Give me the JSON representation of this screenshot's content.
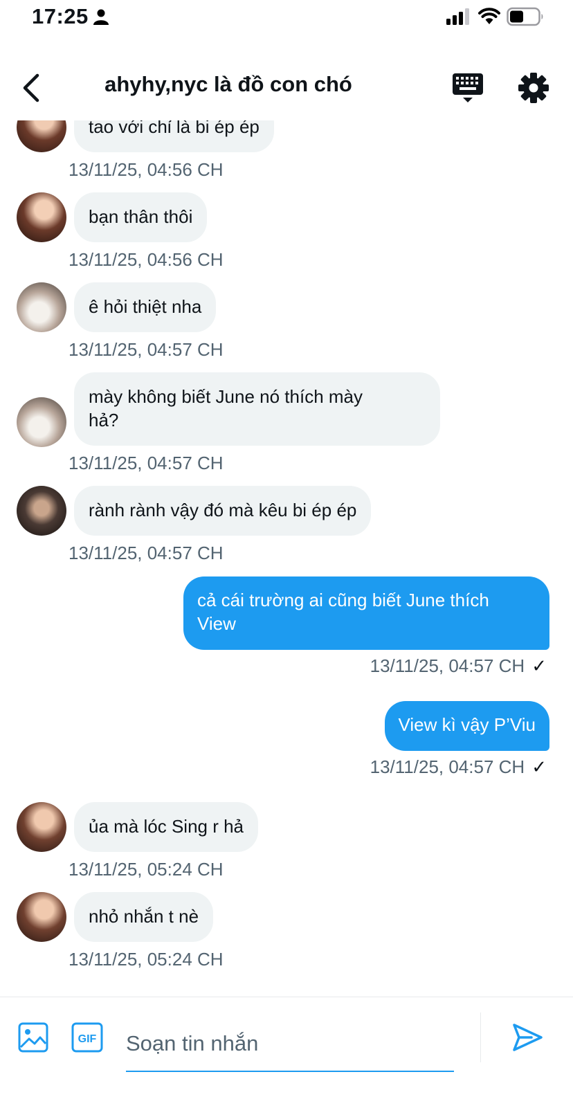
{
  "status_bar": {
    "time": "17:25"
  },
  "header": {
    "title": "ahyhy,nyc là đồ con chó"
  },
  "messages": [
    {
      "text": "tao với chỉ là bi ép ép",
      "time": "13/11/25, 04:56 CH"
    },
    {
      "text": "bạn thân thôi",
      "time": "13/11/25, 04:56 CH"
    },
    {
      "text": "ê hỏi thiệt nha",
      "time": "13/11/25, 04:57 CH"
    },
    {
      "line1": "mày không biết June nó thích mày",
      "line2": "hả?",
      "time": "13/11/25, 04:57 CH"
    },
    {
      "text": "rành rành vậy đó mà kêu bi ép ép",
      "time": "13/11/25, 04:57 CH"
    },
    {
      "line1": "cả cái trường ai cũng biết June thích",
      "line2": "View",
      "time": "13/11/25, 04:57 CH",
      "status": "✓"
    },
    {
      "text": "View kì vậy P’Viu",
      "time": "13/11/25, 04:57 CH",
      "status": "✓"
    },
    {
      "text": "ủa mà lóc Sing r hả",
      "time": "13/11/25, 05:24 CH"
    },
    {
      "text": "nhỏ nhắn t nè",
      "time": "13/11/25, 05:24 CH"
    }
  ],
  "composer": {
    "placeholder": "Soạn tin nhắn",
    "gif_label": "GIF"
  },
  "colors": {
    "accent": "#1d9bf0",
    "incoming_bubble": "#eff3f4",
    "timestamp": "#536471"
  },
  "icons": [
    "person-icon",
    "signal-icon",
    "wifi-icon",
    "battery-icon",
    "back-arrow-icon",
    "keyboard-icon",
    "gear-icon",
    "image-icon",
    "gif-icon",
    "send-icon"
  ]
}
